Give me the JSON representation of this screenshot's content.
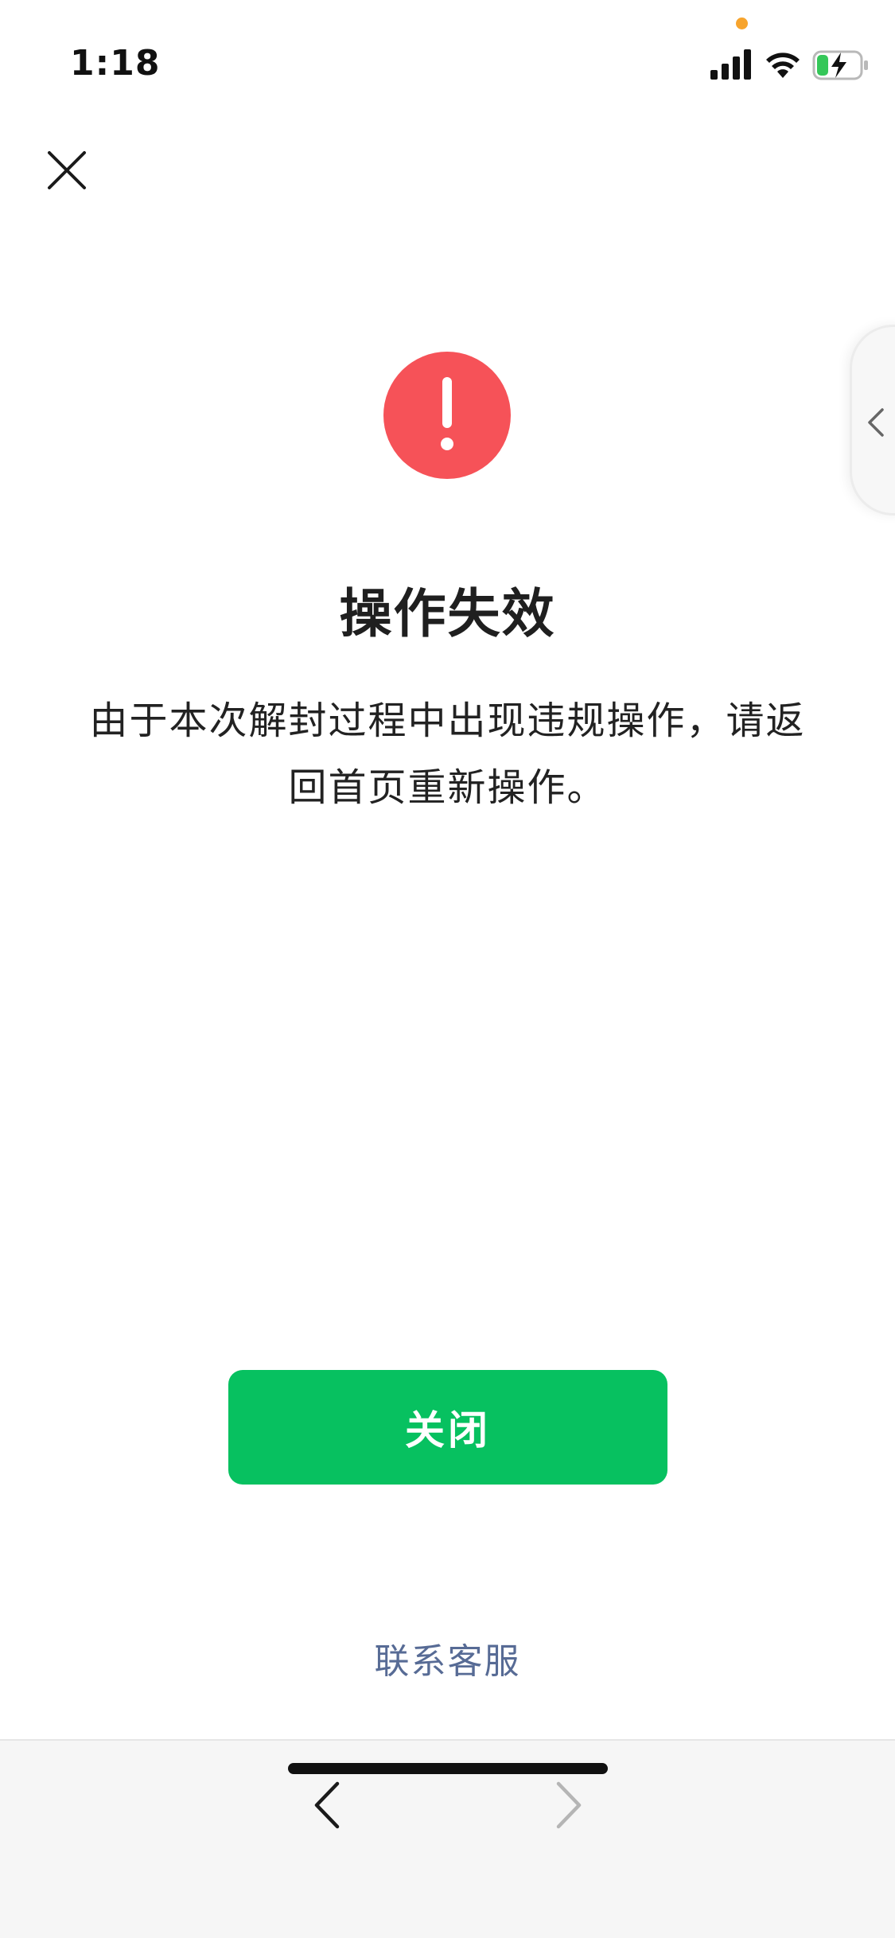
{
  "status_bar": {
    "time": "1:18",
    "icons": [
      "signal-icon",
      "wifi-icon",
      "battery-charging-icon"
    ]
  },
  "header": {
    "close_icon": "close-icon"
  },
  "side_tab": {
    "icon": "chevron-left-icon"
  },
  "result": {
    "icon": "exclamation-icon",
    "icon_color": "#f65258",
    "title": "操作失效",
    "message": "由于本次解封过程中出现违规操作，请返回首页重新操作。"
  },
  "actions": {
    "close_label": "关闭",
    "close_color": "#07c160",
    "contact_label": "联系客服",
    "contact_color": "#576b95"
  },
  "toolbar": {
    "back_icon": "chevron-left-icon",
    "forward_icon": "chevron-right-icon"
  }
}
